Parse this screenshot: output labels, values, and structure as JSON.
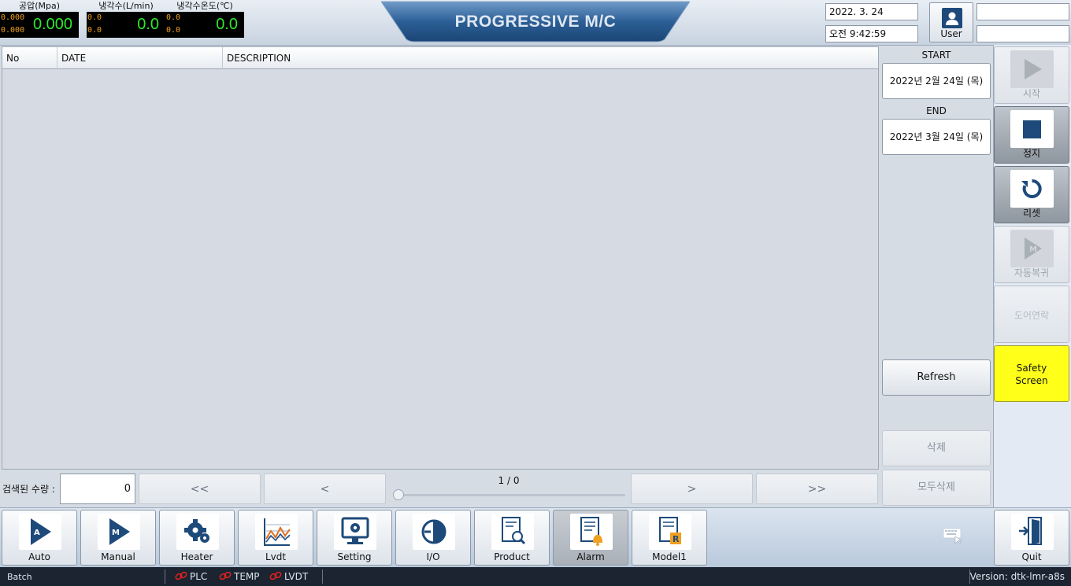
{
  "gauges": [
    {
      "label": "공압(Mpa)",
      "small1": "0.000",
      "small2": "0.000",
      "value": "0.000"
    },
    {
      "label": "냉각수(L/min)",
      "small1": "0.0",
      "small2": "0.0",
      "value": "0.0"
    },
    {
      "label": "냉각수온도(℃)",
      "small1": "0.0",
      "small2": "0.0",
      "value": "0.0"
    }
  ],
  "title": "PROGRESSIVE M/C",
  "header": {
    "date": "2022. 3. 24",
    "time": "오전 9:42:59",
    "user_label": "User"
  },
  "table": {
    "columns": [
      "No",
      "DATE",
      "DESCRIPTION"
    ]
  },
  "filter": {
    "start_label": "START",
    "start_date": "2022년 2월 24일 (목)",
    "end_label": "END",
    "end_date": "2022년 3월 24일 (목)",
    "refresh": "Refresh",
    "delete": "삭제",
    "delete_all": "모두삭제"
  },
  "pager": {
    "search_label": "검색된 수량 :",
    "count": "0",
    "first": "<<",
    "prev": "<",
    "next": ">",
    "last": ">>",
    "page_text": "1 / 0",
    "slider_position": 0
  },
  "control": {
    "start": "시작",
    "stop": "정지",
    "reset": "리셋",
    "auto_return": "자동복귀",
    "door_interlock": "도어연락",
    "safety_line1": "Safety",
    "safety_line2": "Screen"
  },
  "nav": [
    {
      "label": "Auto",
      "icon": "auto-icon"
    },
    {
      "label": "Manual",
      "icon": "manual-icon"
    },
    {
      "label": "Heater",
      "icon": "gear-icon"
    },
    {
      "label": "Lvdt",
      "icon": "chart-icon"
    },
    {
      "label": "Setting",
      "icon": "monitor-gear-icon"
    },
    {
      "label": "I/O",
      "icon": "io-icon"
    },
    {
      "label": "Product",
      "icon": "document-search-icon"
    },
    {
      "label": "Alarm",
      "icon": "document-bell-icon"
    },
    {
      "label": "Model1",
      "icon": "document-r-icon"
    }
  ],
  "quit": "Quit",
  "status": {
    "batch": "Batch",
    "plc": "PLC",
    "temp": "TEMP",
    "lvdt": "LVDT",
    "version": "Version: dtk-lmr-a8s"
  },
  "colors": {
    "accent": "#1d4a7a",
    "gauge_value": "#2ee82e",
    "gauge_small": "#f0a020",
    "safety": "#ffff1a",
    "link_error": "#e02020"
  }
}
